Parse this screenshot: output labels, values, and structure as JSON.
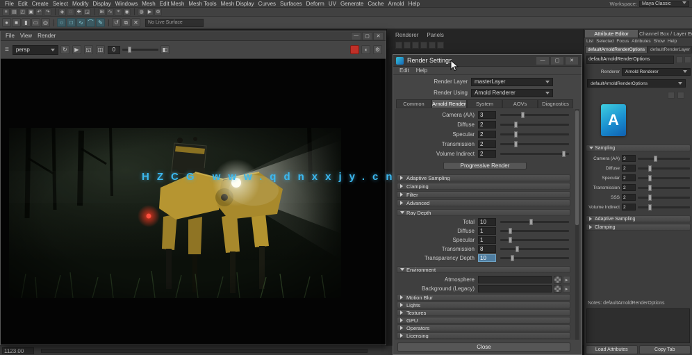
{
  "colors": {
    "accent": "#5285a6",
    "arnold_blue": "#1a8fd0",
    "watermark": "#3cb8ef",
    "stop_red": "#c03028"
  },
  "watermark": {
    "text": "HZCG  www.qdnxxjy.cn"
  },
  "window_buttons": {
    "minimize": "—",
    "maximize": "▢",
    "close": "✕"
  },
  "top": {
    "menus": [
      "File",
      "Edit",
      "Create",
      "Select",
      "Modify",
      "Display",
      "Windows",
      "Mesh",
      "Edit Mesh",
      "Mesh Tools",
      "Mesh Display",
      "Curves",
      "Surfaces",
      "Deform",
      "UV",
      "Generate",
      "Cache",
      "Arnold",
      "Help"
    ],
    "workspace_label": "Workspace:",
    "workspace_value": "Maya Classic"
  },
  "statusline": {
    "icons": [
      {
        "name": "main-menu-icon",
        "glyph": "≡"
      },
      {
        "name": "new-scene-icon",
        "glyph": "▤"
      },
      {
        "name": "open-scene-icon",
        "glyph": "◰"
      },
      {
        "name": "save-scene-icon",
        "glyph": "▣"
      },
      {
        "name": "undo-icon",
        "glyph": "↶"
      },
      {
        "name": "redo-icon",
        "glyph": "↷"
      },
      {
        "name": "select-mask-icon",
        "glyph": "◈"
      },
      {
        "name": "lasso-select-icon",
        "glyph": "◌"
      },
      {
        "name": "move-tool-icon",
        "glyph": "✚"
      },
      {
        "name": "scale-tool-icon",
        "glyph": "◲"
      },
      {
        "name": "snap-grid-icon",
        "glyph": "⊞"
      },
      {
        "name": "snap-curve-icon",
        "glyph": "∿"
      },
      {
        "name": "snap-point-icon",
        "glyph": "⌖"
      },
      {
        "name": "snap-view-icon",
        "glyph": "◉"
      },
      {
        "name": "render-current-frame-icon",
        "glyph": "◍"
      },
      {
        "name": "ipr-render-icon",
        "glyph": "▶"
      },
      {
        "name": "render-settings-icon",
        "glyph": "⚙"
      }
    ]
  },
  "shelf": {
    "icons": [
      {
        "name": "poly-sphere-icon",
        "glyph": "●"
      },
      {
        "name": "poly-cube-icon",
        "glyph": "■"
      },
      {
        "name": "poly-cylinder-icon",
        "glyph": "▮"
      },
      {
        "name": "poly-plane-icon",
        "glyph": "▭"
      },
      {
        "name": "poly-torus-icon",
        "glyph": "◎"
      },
      {
        "name": "nurbs-circle-icon",
        "glyph": "○"
      },
      {
        "name": "nurbs-square-icon",
        "glyph": "□"
      },
      {
        "name": "curve-tool-icon",
        "glyph": "∿"
      },
      {
        "name": "arc-tool-icon",
        "glyph": "⌒"
      },
      {
        "name": "pencil-curve-icon",
        "glyph": "✎"
      },
      {
        "name": "history-icon",
        "glyph": "↺"
      },
      {
        "name": "duplicate-icon",
        "glyph": "⧉"
      },
      {
        "name": "delete-icon",
        "glyph": "✕"
      }
    ],
    "live_surface": "No Live Surface"
  },
  "bg_panel": {
    "menu_fragment": [
      "Renderer",
      "Panels"
    ]
  },
  "viewport": {
    "menus": [
      "File",
      "View",
      "Render"
    ],
    "toolbar": {
      "burger": "≡",
      "camera": "persp",
      "icons": [
        {
          "name": "refresh-render-icon",
          "glyph": "↻"
        },
        {
          "name": "ipr-icon",
          "glyph": "▶"
        },
        {
          "name": "region-render-icon",
          "glyph": "◱"
        },
        {
          "name": "snapshot-icon",
          "glyph": "◫"
        }
      ],
      "gamma_value": "0",
      "gamma_pct": 15,
      "display_channel_icon": "◧",
      "audio_icon": "◖",
      "gear_icon": "⚙"
    }
  },
  "render_settings": {
    "title": "Render Settings",
    "menus": [
      "Edit",
      "Help"
    ],
    "render_layer": {
      "label": "Render Layer",
      "value": "masterLayer"
    },
    "render_using": {
      "label": "Render Using",
      "value": "Arnold Renderer"
    },
    "tabs": [
      "Common",
      "Arnold Renderer",
      "System",
      "AOVs",
      "Diagnostics"
    ],
    "active_tab": "Arnold Renderer",
    "sampling_rows": [
      {
        "label": "Camera (AA)",
        "value": "3",
        "pct": 30
      },
      {
        "label": "Diffuse",
        "value": "2",
        "pct": 20
      },
      {
        "label": "Specular",
        "value": "2",
        "pct": 20
      },
      {
        "label": "Transmission",
        "value": "2",
        "pct": 20
      },
      {
        "label": "Volume Indirect",
        "value": "2",
        "pct": 90
      }
    ],
    "progressive_button": "Progressive Render",
    "collapsed_a": [
      "Adaptive Sampling",
      "Clamping",
      "Filter",
      "Advanced"
    ],
    "ray_depth": {
      "title": "Ray Depth",
      "rows": [
        {
          "label": "Total",
          "value": "10",
          "pct": 42
        },
        {
          "label": "Diffuse",
          "value": "1",
          "pct": 12
        },
        {
          "label": "Specular",
          "value": "1",
          "pct": 12
        },
        {
          "label": "Transmission",
          "value": "8",
          "pct": 22
        },
        {
          "label": "Transparency Depth",
          "value": "10",
          "pct": 15,
          "highlight": true
        }
      ]
    },
    "environment": {
      "title": "Environment",
      "rows": [
        {
          "label": "Atmosphere"
        },
        {
          "label": "Background (Legacy)"
        }
      ]
    },
    "collapsed_b": [
      "Motion Blur",
      "Lights",
      "Textures",
      "GPU",
      "Operators",
      "Licensing"
    ],
    "close_button": "Close"
  },
  "attribute_editor": {
    "panel_tabs": [
      "Attribute Editor",
      "Channel Box / Layer Editor"
    ],
    "menus": [
      "List",
      "Selected",
      "Focus",
      "Attributes",
      "Show",
      "Help"
    ],
    "node_tabs": [
      "defaultArnoldRenderOptions",
      "defaultRenderLayer"
    ],
    "node_name": "defaultArnoldRenderOptions",
    "renderer": {
      "label": "Renderer",
      "value": "Arnold Renderer"
    },
    "node_select_value": "defaultArnoldRenderOptions",
    "logo_letter": "A",
    "sampling_title": "Sampling",
    "rows": [
      {
        "label": "Camera (AA)",
        "value": "3",
        "pct": 30
      },
      {
        "label": "Diffuse",
        "value": "2",
        "pct": 20
      },
      {
        "label": "Specular",
        "value": "2",
        "pct": 20
      },
      {
        "label": "Transmission",
        "value": "2",
        "pct": 20
      },
      {
        "label": "SSS",
        "value": "2",
        "pct": 20
      },
      {
        "label": "Volume Indirect",
        "value": "2",
        "pct": 20
      }
    ],
    "collapsed": [
      "Adaptive Sampling",
      "Clamping"
    ],
    "notes_label": "Notes: defaultArnoldRenderOptions",
    "buttons": [
      "Load Attributes",
      "Copy Tab"
    ]
  },
  "bottom_bar": {
    "status": "1123.00"
  }
}
